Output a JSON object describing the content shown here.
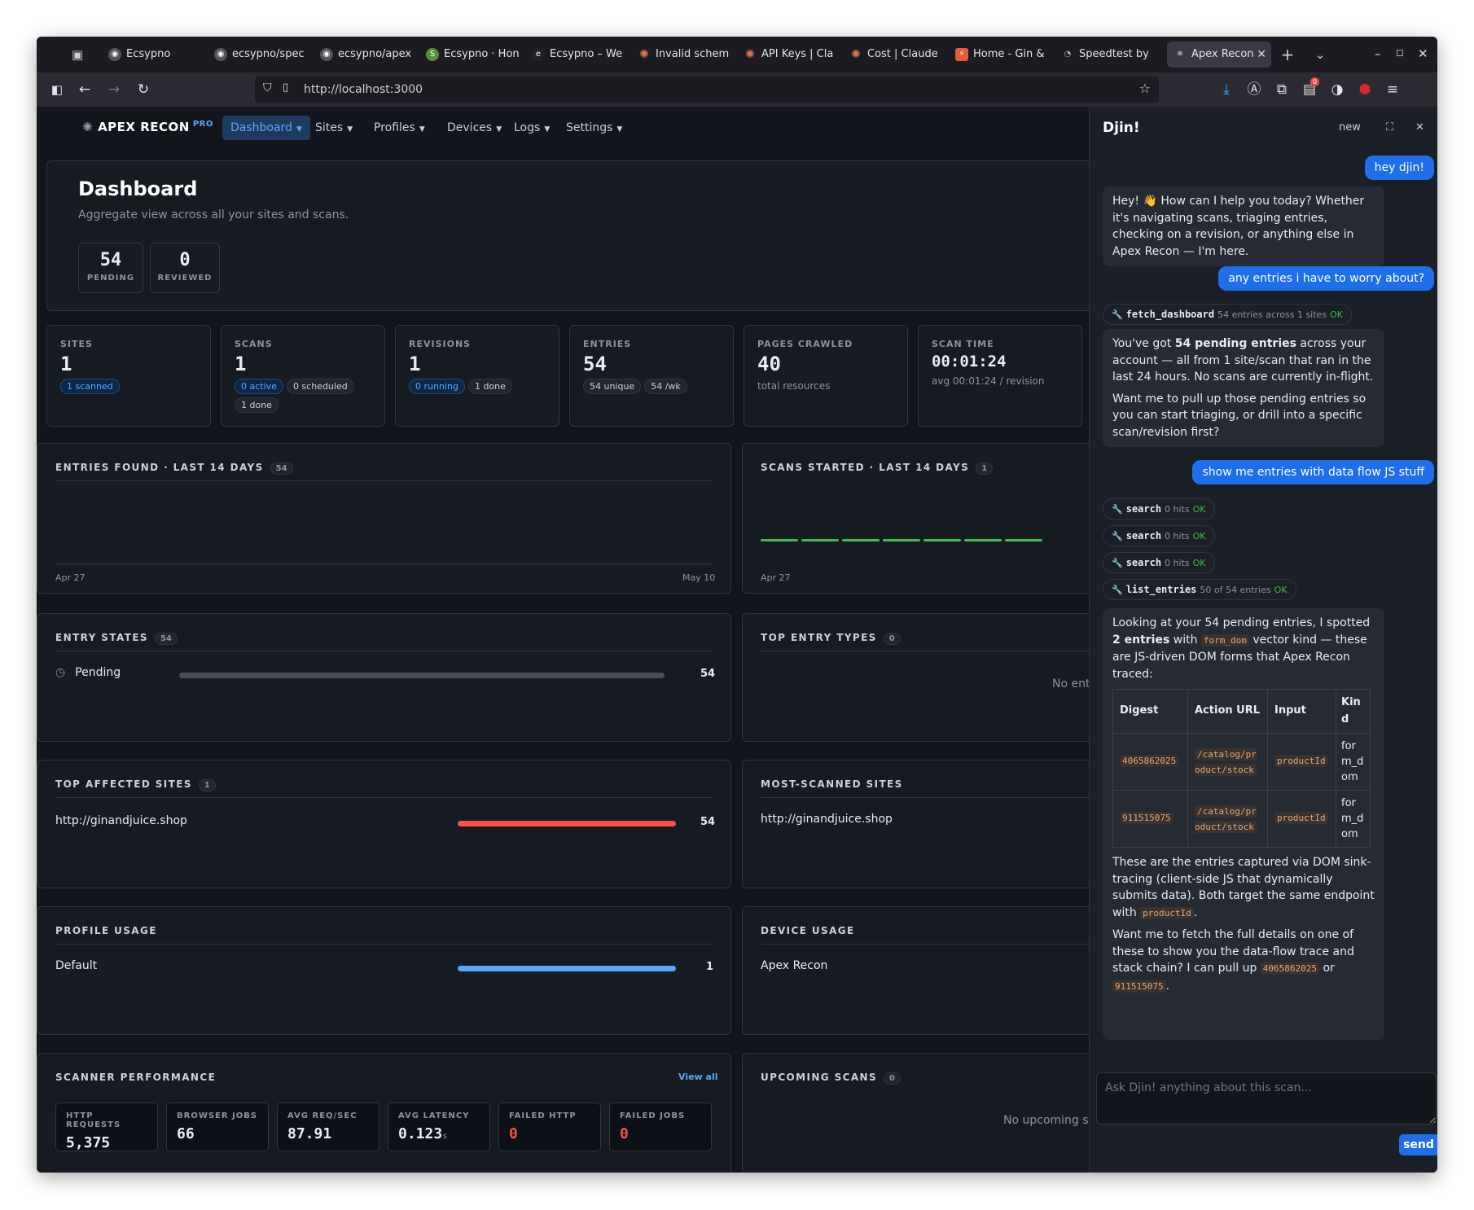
{
  "browser": {
    "tabs": [
      {
        "label": "Ecsypno",
        "icon": "github-icon"
      },
      {
        "label": "ecsypno/spec",
        "icon": "github-icon"
      },
      {
        "label": "ecsypno/apex",
        "icon": "github-icon"
      },
      {
        "label": "Ecsypno · Hon",
        "icon": "shopify-icon"
      },
      {
        "label": "Ecsypno – We",
        "icon": "edge-icon"
      },
      {
        "label": "Invalid schem",
        "icon": "claude-icon"
      },
      {
        "label": "API Keys | Cla",
        "icon": "claude-icon"
      },
      {
        "label": "Cost | Claude",
        "icon": "claude-icon"
      },
      {
        "label": "Home - Gin &",
        "icon": "lightning-icon"
      },
      {
        "label": "Speedtest by",
        "icon": "speedtest-icon"
      },
      {
        "label": "Apex Recon",
        "icon": "apex-icon"
      }
    ],
    "url": "http://localhost:3000",
    "extension_badge": "0"
  },
  "app": {
    "brand": "APEX RECON",
    "brand_badge": "PRO",
    "menu": [
      "Dashboard",
      "Sites",
      "Profiles",
      "Devices",
      "Logs",
      "Settings"
    ]
  },
  "dashboard": {
    "title": "Dashboard",
    "subtitle": "Aggregate view across all your sites and scans.",
    "pending": {
      "value": "54",
      "label": "PENDING"
    },
    "reviewed": {
      "value": "0",
      "label": "REVIEWED"
    }
  },
  "stats": {
    "sites": {
      "label": "SITES",
      "value": "1",
      "chips": [
        "1 scanned"
      ]
    },
    "scans": {
      "label": "SCANS",
      "value": "1",
      "chips": [
        "0 active",
        "0 scheduled",
        "1 done"
      ]
    },
    "revisions": {
      "label": "REVISIONS",
      "value": "1",
      "chips": [
        "0 running",
        "1 done"
      ]
    },
    "entries": {
      "label": "ENTRIES",
      "value": "54",
      "chips": [
        "54 unique",
        "54 /wk"
      ]
    },
    "pages": {
      "label": "PAGES CRAWLED",
      "value": "40",
      "sub": "total resources"
    },
    "scantime": {
      "label": "SCAN TIME",
      "value": "00:01:24",
      "sub": "avg 00:01:24 / revision"
    }
  },
  "panels": {
    "entries_found": {
      "title": "ENTRIES FOUND · LAST 14 DAYS",
      "count": "54",
      "x_start": "Apr 27",
      "x_end": "May 10"
    },
    "scans_started": {
      "title": "SCANS STARTED · LAST 14 DAYS",
      "count": "1",
      "x_start": "Apr 27"
    },
    "entry_states": {
      "title": "ENTRY STATES",
      "count": "54",
      "rows": [
        {
          "label": "Pending",
          "value": "54",
          "fraction": 1.0
        }
      ]
    },
    "top_entry_types": {
      "title": "TOP ENTRY TYPES",
      "count": "0",
      "empty": "No entri"
    },
    "top_sites": {
      "title": "TOP AFFECTED SITES",
      "count": "1",
      "rows": [
        {
          "label": "http://ginandjuice.shop",
          "value": "54",
          "fraction": 1.0
        }
      ]
    },
    "most_scanned": {
      "title": "MOST-SCANNED SITES",
      "rows": [
        {
          "label": "http://ginandjuice.shop"
        }
      ]
    },
    "profile_usage": {
      "title": "PROFILE USAGE",
      "rows": [
        {
          "label": "Default",
          "value": "1",
          "fraction": 1.0
        }
      ]
    },
    "device_usage": {
      "title": "DEVICE USAGE",
      "rows": [
        {
          "label": "Apex Recon"
        }
      ]
    },
    "scanner_perf": {
      "title": "SCANNER PERFORMANCE",
      "link": "View all",
      "metrics": [
        {
          "label": "HTTP REQUESTS",
          "value": "5,375",
          "unit": ""
        },
        {
          "label": "BROWSER JOBS",
          "value": "66",
          "unit": ""
        },
        {
          "label": "AVG REQ/SEC",
          "value": "87.91",
          "unit": ""
        },
        {
          "label": "AVG LATENCY",
          "value": "0.123",
          "unit": "s"
        },
        {
          "label": "FAILED HTTP",
          "value": "0",
          "unit": ""
        },
        {
          "label": "FAILED JOBS",
          "value": "0",
          "unit": ""
        }
      ]
    },
    "upcoming": {
      "title": "UPCOMING SCANS",
      "count": "0",
      "empty": "No upcoming s"
    }
  },
  "chat": {
    "title": "Djin!",
    "new_label": "new",
    "messages": {
      "u1": "hey djin!",
      "a1": "Hey! 👋 How can I help you today? Whether it's navigating scans, triaging entries, checking on a revision, or anything else in Apex Recon — I'm here.",
      "u2": "any entries i have to worry about?",
      "t1": {
        "name": "fetch_dashboard",
        "info": "54 entries across 1 sites",
        "status": "OK"
      },
      "a2_p1_pre": "You've got ",
      "a2_p1_bold": "54 pending entries",
      "a2_p1_post": " across your account — all from 1 site/scan that ran in the last 24 hours. No scans are currently in-flight.",
      "a2_p2": "Want me to pull up those pending entries so you can start triaging, or drill into a specific scan/revision first?",
      "u3": "show me entries with data flow JS stuff",
      "t2": {
        "name": "search",
        "info": "0 hits",
        "status": "OK"
      },
      "t3": {
        "name": "search",
        "info": "0 hits",
        "status": "OK"
      },
      "t4": {
        "name": "search",
        "info": "0 hits",
        "status": "OK"
      },
      "t5": {
        "name": "list_entries",
        "info": "50 of 54 entries",
        "status": "OK"
      },
      "a3_p1_pre": "Looking at your 54 pending entries, I spotted ",
      "a3_p1_bold": "2 entries",
      "a3_p1_mid": " with ",
      "a3_p1_code": "form_dom",
      "a3_p1_post": " vector kind — these are JS-driven DOM forms that Apex Recon traced:",
      "table": {
        "headers": [
          "Digest",
          "Action URL",
          "Input",
          "Kind"
        ],
        "rows": [
          {
            "digest": "4065862025",
            "url": "/catalog/product/stock",
            "input": "productId",
            "kind": "form_dom"
          },
          {
            "digest": "911515075",
            "url": "/catalog/product/stock",
            "input": "productId",
            "kind": "form_dom"
          }
        ]
      },
      "a3_p2_pre": "These are the entries captured via DOM sink-tracing (client-side JS that dynamically submits data). Both target the same endpoint with ",
      "a3_p2_code": "productId",
      "a3_p2_post": ".",
      "a3_p3_pre": "Want me to fetch the full details on one of these to show you the data-flow trace and stack chain? I can pull up ",
      "a3_p3_code1": "4065862025",
      "a3_p3_mid": " or ",
      "a3_p3_code2": "911515075",
      "a3_p3_post": "."
    },
    "input_placeholder": "Ask Djin! anything about this scan...",
    "send_label": "send"
  },
  "colors": {
    "accent": "#58a6ff",
    "danger": "#f85149",
    "success": "#3fb950",
    "bar_gray": "#6e7681"
  }
}
